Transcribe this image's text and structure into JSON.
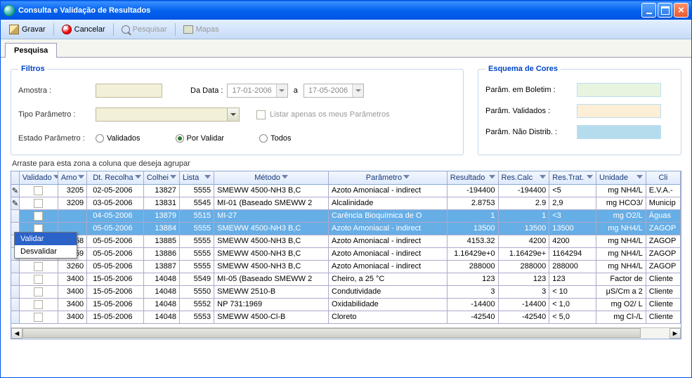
{
  "window": {
    "title": "Consulta e Validação de Resultados"
  },
  "toolbar": {
    "save": "Gravar",
    "cancel": "Cancelar",
    "search": "Pesquisar",
    "maps": "Mapas"
  },
  "tab": {
    "label": "Pesquisa"
  },
  "filters": {
    "legend": "Filtros",
    "sample_label": "Amostra :",
    "from_label": "Da Data :",
    "from_value": "17-01-2006",
    "to_sep": "a",
    "to_value": "17-05-2006",
    "paramtype_label": "Tipo Parâmetro :",
    "onlymine_label": "Listar apenas os meus Parâmetros",
    "state_label": "Estado Parâmetro :",
    "state_validated": "Validados",
    "state_tovalidate": "Por Validar",
    "state_all": "Todos"
  },
  "colors": {
    "legend": "Esquema de Cores",
    "bulletin": "Parâm. em Boletim :",
    "validated": "Parâm. Validados :",
    "notdist": "Parâm. Não Distrib. :",
    "c1": "#e7f5e0",
    "c2": "#fcefd6",
    "c3": "#b5dced"
  },
  "group_bar": "Arraste para esta zona a coluna que deseja agrupar",
  "columns": {
    "validado": "Validado",
    "amo": "Amo",
    "dtrec": "Dt. Recolha",
    "colhei": "Colhei",
    "lista": "Lista",
    "metodo": "Método",
    "parametro": "Parâmetro",
    "resultado": "Resultado",
    "rescalc": "Res.Calc",
    "restrat": "Res.Trat.",
    "unidade": "Unidade",
    "cli": "Cli"
  },
  "context_menu": {
    "validar": "Validar",
    "desvalidar": "Desvalidar"
  },
  "rows": [
    {
      "amo": "3205",
      "dt": "02-05-2006",
      "col": "13827",
      "lis": "5555",
      "met": "SMEWW 4500-NH3 B,C",
      "par": "Azoto Amoniacal - indirect",
      "res": "-194400",
      "resc": "-194400",
      "rest": "<5",
      "uni": "mg NH4/L",
      "cli": "E.V.A.-"
    },
    {
      "amo": "3209",
      "dt": "03-05-2006",
      "col": "13831",
      "lis": "5545",
      "met": "MI-01 (Baseado SMEWW 2",
      "par": "Alcalinidade",
      "res": "2.8753",
      "resc": "2.9",
      "rest": "2,9",
      "uni": "mg HCO3/",
      "cli": "Municip"
    },
    {
      "sel": true,
      "amo": "",
      "dt": "04-05-2006",
      "col": "13879",
      "lis": "5515",
      "met": "MI-27",
      "par": "Carência Bioquímica de O",
      "res": "1",
      "resc": "1",
      "rest": "<3",
      "uni": "mg O2/L",
      "cli": "Águas"
    },
    {
      "sel": true,
      "amo": "",
      "dt": "05-05-2006",
      "col": "13884",
      "lis": "5555",
      "met": "SMEWW 4500-NH3 B,C",
      "par": "Azoto Amoniacal - indirect",
      "res": "13500",
      "resc": "13500",
      "rest": "13500",
      "uni": "mg NH4/L",
      "cli": "ZAGOP"
    },
    {
      "amo": "3258",
      "dt": "05-05-2006",
      "col": "13885",
      "lis": "5555",
      "met": "SMEWW 4500-NH3 B,C",
      "par": "Azoto Amoniacal - indirect",
      "res": "4153.32",
      "resc": "4200",
      "rest": "4200",
      "uni": "mg NH4/L",
      "cli": "ZAGOP"
    },
    {
      "amo": "3259",
      "dt": "05-05-2006",
      "col": "13886",
      "lis": "5555",
      "met": "SMEWW 4500-NH3 B,C",
      "par": "Azoto Amoniacal - indirect",
      "res": "1.16429e+0",
      "resc": "1.16429e+",
      "rest": "1164294",
      "uni": "mg NH4/L",
      "cli": "ZAGOP"
    },
    {
      "amo": "3260",
      "dt": "05-05-2006",
      "col": "13887",
      "lis": "5555",
      "met": "SMEWW 4500-NH3 B,C",
      "par": "Azoto Amoniacal - indirect",
      "res": "288000",
      "resc": "288000",
      "rest": "288000",
      "uni": "mg NH4/L",
      "cli": "ZAGOP"
    },
    {
      "amo": "3400",
      "dt": "15-05-2006",
      "col": "14048",
      "lis": "5549",
      "met": "MI-05 (Baseado SMEWW 2",
      "par": "Cheiro, a 25 °C",
      "res": "123",
      "resc": "123",
      "rest": "123",
      "uni": "Factor de",
      "cli": "Cliente"
    },
    {
      "amo": "3400",
      "dt": "15-05-2006",
      "col": "14048",
      "lis": "5550",
      "met": "SMEWW 2510-B",
      "par": "Condutividade",
      "res": "3",
      "resc": "3",
      "rest": "< 10",
      "uni": "μS/Cm a 2",
      "cli": "Cliente"
    },
    {
      "amo": "3400",
      "dt": "15-05-2006",
      "col": "14048",
      "lis": "5552",
      "met": "NP 731:1969",
      "par": "Oxidabilidade",
      "res": "-14400",
      "resc": "-14400",
      "rest": "< 1,0",
      "uni": "mg O2/ L",
      "cli": "Cliente"
    },
    {
      "amo": "3400",
      "dt": "15-05-2006",
      "col": "14048",
      "lis": "5553",
      "met": "SMEWW 4500-Cl-B",
      "par": "Cloreto",
      "res": "-42540",
      "resc": "-42540",
      "rest": "< 5,0",
      "uni": "mg Cl-/L",
      "cli": "Cliente"
    }
  ]
}
